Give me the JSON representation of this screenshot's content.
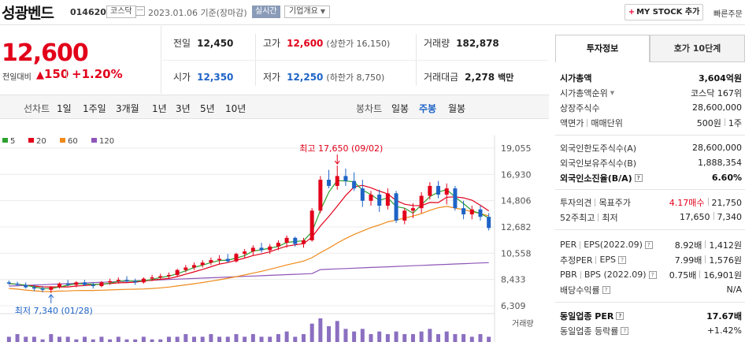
{
  "header": {
    "name": "성광벤드",
    "code": "014620",
    "market": "코스닥",
    "date": "2023.01.06  기준(장마감)",
    "realtime": "실시간",
    "overview": "기업개요",
    "mystock": "MY STOCK 추가",
    "quick": "빠른주문"
  },
  "price": {
    "current": "12,600",
    "change_label": "전일대비",
    "change": "150",
    "change_pct": "+1.20%"
  },
  "summary": {
    "prev_label": "전일",
    "prev": "12,450",
    "high_label": "고가",
    "high": "12,600",
    "upper_label": "(상한가 16,150)",
    "volume_label": "거래량",
    "volume": "182,878",
    "open_label": "시가",
    "open": "12,350",
    "low_label": "저가",
    "low": "12,250",
    "lower_label": "(하한가 8,750)",
    "amount_label": "거래대금",
    "amount": "2,278",
    "amount_unit": "백만"
  },
  "toolbar": {
    "line_label": "선차트",
    "line_periods": [
      "1일",
      "1주일",
      "3개월",
      "1년",
      "3년",
      "5년",
      "10년"
    ],
    "candle_label": "봉차트",
    "candle_periods": [
      "일봉",
      "주봉",
      "월봉"
    ],
    "candle_active": "주봉"
  },
  "chart_data": {
    "type": "candlestick",
    "interval": "weekly",
    "legend": [
      "5",
      "20",
      "60",
      "120"
    ],
    "colors": {
      "ma5": "#2ea02e",
      "ma20": "#e2001a",
      "ma60": "#ef8a1a",
      "ma120": "#8e55b8",
      "up": "#e2001a",
      "down": "#1e63c6",
      "volume": "#8b6fc0"
    },
    "ylim": [
      6309,
      19055
    ],
    "y_ticks": [
      "19,055",
      "16,930",
      "14,806",
      "12,682",
      "10,558",
      "8,433",
      "6,309"
    ],
    "high_annotation": "최고 17,650 (09/02)",
    "low_annotation": "최저 7,340 (01/28)",
    "volume_label": "거래량",
    "candles": [
      [
        8200,
        8350,
        8000,
        8100
      ],
      [
        8100,
        8250,
        7900,
        8000
      ],
      [
        8000,
        8200,
        7700,
        7800
      ],
      [
        7800,
        8000,
        7500,
        7700
      ],
      [
        7700,
        7900,
        7400,
        7600
      ],
      [
        7600,
        7900,
        7340,
        7800
      ],
      [
        7800,
        8200,
        7700,
        8100
      ],
      [
        8100,
        8400,
        7900,
        8000
      ],
      [
        8000,
        8300,
        7800,
        8200
      ],
      [
        8200,
        8400,
        7900,
        8000
      ],
      [
        8000,
        8200,
        7700,
        7900
      ],
      [
        7900,
        8300,
        7800,
        8200
      ],
      [
        8200,
        8500,
        8000,
        8300
      ],
      [
        8300,
        8600,
        8100,
        8400
      ],
      [
        8400,
        8700,
        8200,
        8300
      ],
      [
        8300,
        8500,
        8000,
        8200
      ],
      [
        8200,
        8600,
        8100,
        8500
      ],
      [
        8500,
        8800,
        8300,
        8600
      ],
      [
        8600,
        8900,
        8400,
        8700
      ],
      [
        8700,
        9000,
        8500,
        8800
      ],
      [
        8800,
        9300,
        8700,
        9200
      ],
      [
        9200,
        9600,
        9000,
        9400
      ],
      [
        9400,
        9800,
        9200,
        9600
      ],
      [
        9600,
        10000,
        9400,
        9800
      ],
      [
        9800,
        10200,
        9600,
        10000
      ],
      [
        10000,
        10400,
        9700,
        10100
      ],
      [
        10100,
        10500,
        9800,
        9900
      ],
      [
        9900,
        10600,
        9800,
        10500
      ],
      [
        10500,
        10900,
        10200,
        10700
      ],
      [
        10700,
        11200,
        10400,
        11000
      ],
      [
        11000,
        11400,
        10600,
        10800
      ],
      [
        10800,
        11300,
        10500,
        11100
      ],
      [
        11100,
        11600,
        10800,
        11400
      ],
      [
        11400,
        12000,
        11000,
        11800
      ],
      [
        11800,
        11900,
        11100,
        11300
      ],
      [
        11300,
        11800,
        11000,
        11600
      ],
      [
        11600,
        14200,
        11500,
        14000
      ],
      [
        14000,
        16800,
        13800,
        16500
      ],
      [
        16500,
        17300,
        15800,
        16000
      ],
      [
        16000,
        17650,
        15700,
        16800
      ],
      [
        16800,
        17400,
        16000,
        16400
      ],
      [
        16400,
        17100,
        15600,
        15800
      ],
      [
        15800,
        16500,
        14300,
        14800
      ],
      [
        14800,
        15600,
        14400,
        15300
      ],
      [
        15300,
        15700,
        13900,
        14400
      ],
      [
        14400,
        15800,
        14100,
        15400
      ],
      [
        15400,
        15600,
        13000,
        13200
      ],
      [
        13200,
        14200,
        12900,
        14000
      ],
      [
        14000,
        14600,
        13400,
        14200
      ],
      [
        14200,
        15500,
        13800,
        15200
      ],
      [
        15200,
        16300,
        14900,
        16000
      ],
      [
        16000,
        16400,
        15000,
        15300
      ],
      [
        15300,
        16200,
        14500,
        15800
      ],
      [
        15800,
        16000,
        14000,
        14200
      ],
      [
        14200,
        14800,
        13300,
        13700
      ],
      [
        13700,
        14400,
        13300,
        14100
      ],
      [
        14100,
        14400,
        13200,
        13500
      ],
      [
        13500,
        13800,
        12400,
        12600
      ]
    ],
    "volumes": [
      2,
      3,
      2,
      2,
      1,
      3,
      2,
      2,
      1,
      2,
      1,
      2,
      1,
      2,
      1,
      1,
      2,
      1,
      1,
      2,
      2,
      3,
      2,
      2,
      3,
      2,
      2,
      3,
      2,
      3,
      2,
      2,
      3,
      4,
      2,
      3,
      7,
      9,
      6,
      8,
      5,
      4,
      5,
      3,
      4,
      3,
      4,
      3,
      3,
      4,
      5,
      3,
      4,
      3,
      3,
      2,
      3,
      2
    ]
  },
  "panel": {
    "tab_active": "투자정보",
    "tab_other": "호가 10단계",
    "market_cap_label": "시가총액",
    "market_cap": "3,604억원",
    "rank_label": "시가총액순위",
    "rank": "코스닥 167위",
    "shares_label": "상장주식수",
    "shares": "28,600,000",
    "par_label": "액면가",
    "unit_label": "매매단위",
    "par": "500원",
    "unit": "1주",
    "foreign_limit_label": "외국인한도주식수(A)",
    "foreign_limit": "28,600,000",
    "foreign_hold_label": "외국인보유주식수(B)",
    "foreign_hold": "1,888,354",
    "foreign_ratio_label": "외국인소진율(B/A)",
    "foreign_ratio": "6.60%",
    "opinion_label": "투자의견",
    "target_label": "목표주가",
    "opinion": "4.17매수",
    "target": "21,750",
    "w52_label": "52주최고",
    "w52_low_label": "최저",
    "w52_high": "17,650",
    "w52_low": "7,340",
    "per_label": "PER",
    "eps_label": "EPS(2022.09)",
    "per": "8.92배",
    "eps": "1,412원",
    "est_per_label": "추정PER",
    "est_eps_label": "EPS",
    "est_per": "7.99배",
    "est_eps": "1,576원",
    "pbr_label": "PBR",
    "bps_label": "BPS (2022.09)",
    "pbr": "0.75배",
    "bps": "16,901원",
    "div_label": "배당수익률",
    "div": "N/A",
    "ind_per_label": "동일업종 PER",
    "ind_per": "17.67배",
    "ind_rate_label": "동일업종 등락률",
    "ind_rate": "+1.42%"
  }
}
